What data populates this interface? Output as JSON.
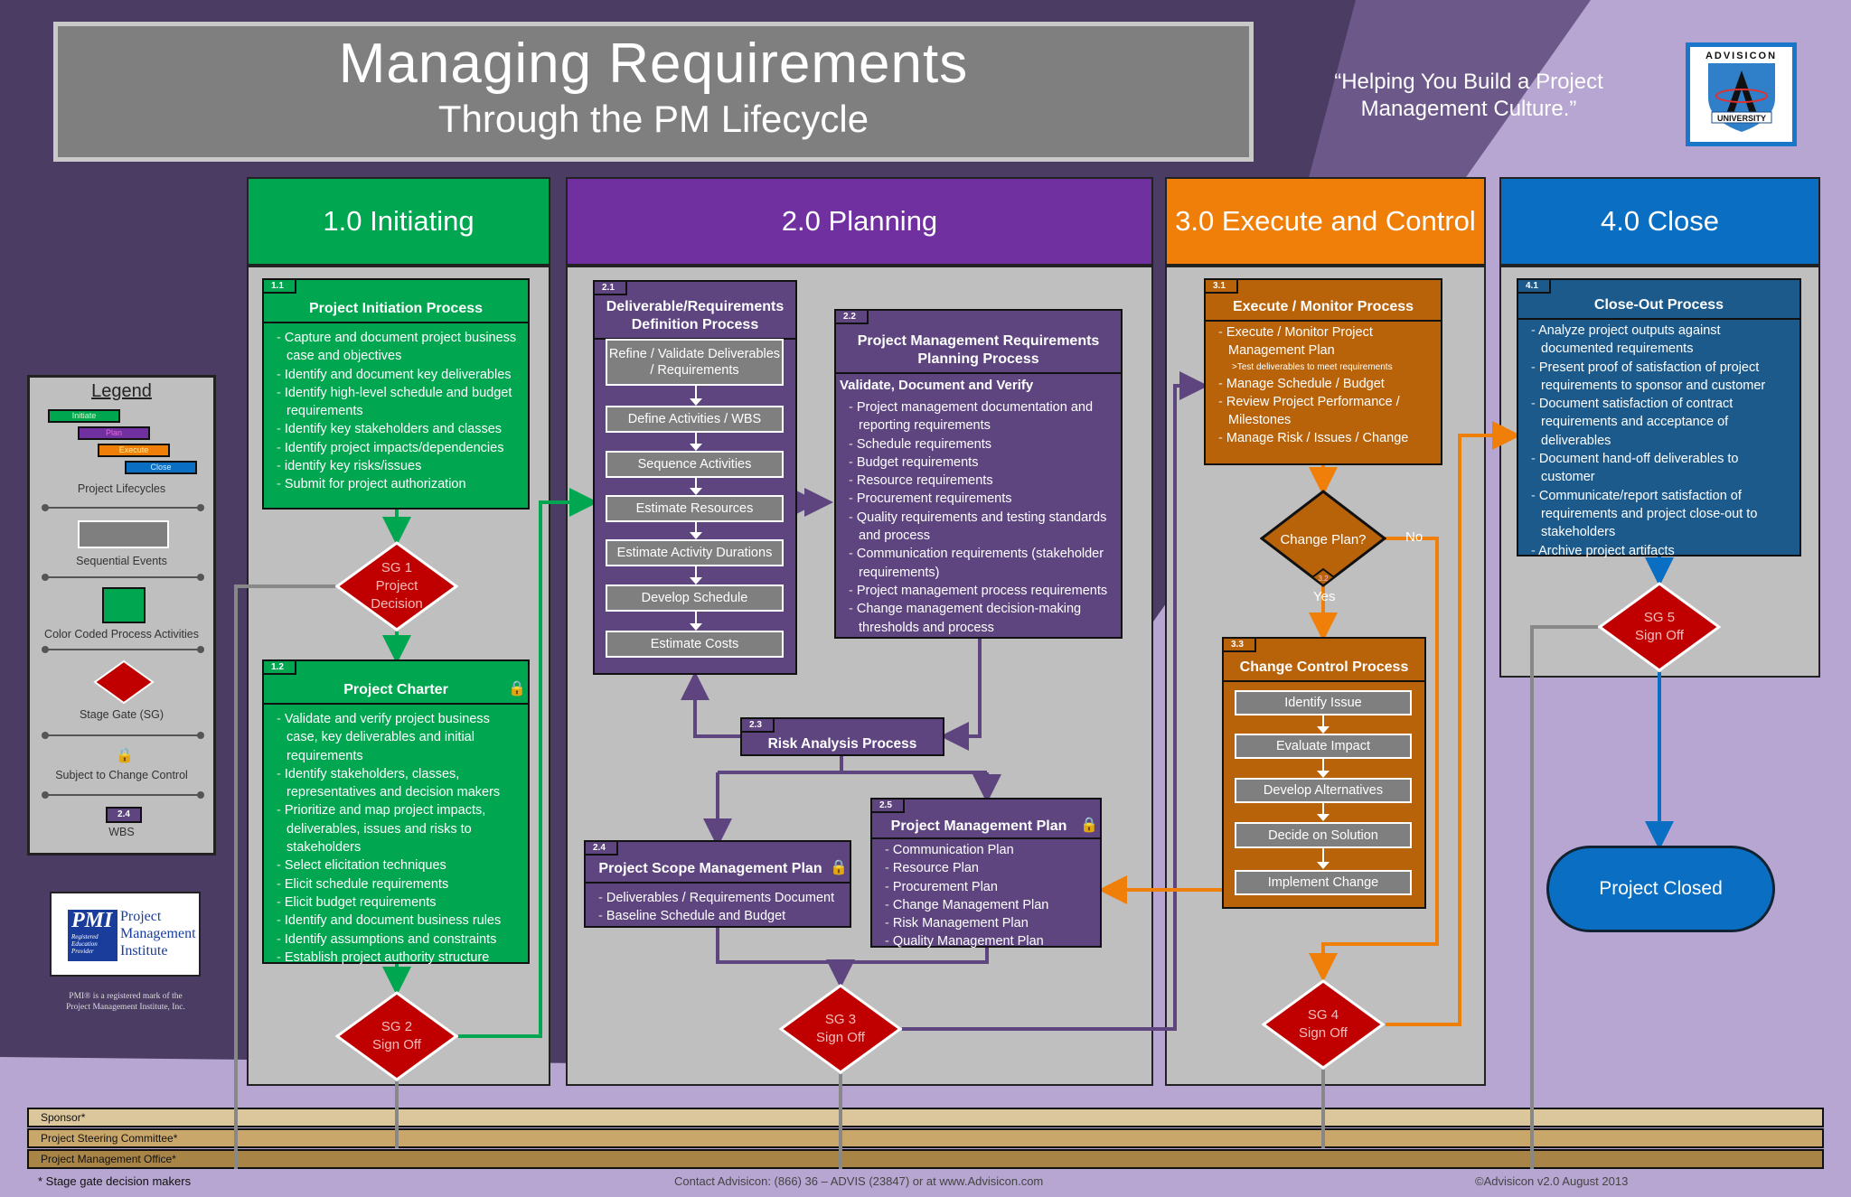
{
  "header": {
    "title": "Managing Requirements",
    "subtitle": "Through the PM Lifecycle",
    "tagline": "“Helping You Build a Project Management Culture.”",
    "logo_top": "ADVISICON",
    "logo_bottom": "UNIVERSITY"
  },
  "colors": {
    "initiate": "#00a650",
    "plan": "#7030a0",
    "execute": "#f07f0a",
    "close": "#0a6fc2",
    "gate": "#c00000",
    "process_purple": "#5e4580",
    "process_orange": "#b8630a",
    "process_blue": "#1c5a8c",
    "background": "#4a3c63"
  },
  "phases": [
    {
      "label": "1.0 Initiating"
    },
    {
      "label": "2.0 Planning"
    },
    {
      "label": "3.0 Execute and Control"
    },
    {
      "label": "4.0 Close"
    }
  ],
  "initiation": {
    "wbs": "1.1",
    "title": "Project Initiation Process",
    "items": [
      "Capture and document project business case and objectives",
      "Identify and document key deliverables",
      "Identify high-level schedule and budget requirements",
      "Identify key stakeholders and classes",
      "Identify project impacts/dependencies",
      "identify key risks/issues",
      "Submit for project authorization"
    ]
  },
  "charter": {
    "wbs": "1.2",
    "title": "Project Charter",
    "items": [
      "Validate and verify project business case, key deliverables and initial requirements",
      "Identify stakeholders, classes, representatives and decision makers",
      "Prioritize and map project impacts, deliverables, issues and risks to stakeholders",
      "Select elicitation techniques",
      "Elicit schedule requirements",
      "Elicit budget requirements",
      "Identify and document business rules",
      "Identify assumptions and constraints",
      "Establish project authority structure"
    ]
  },
  "definition": {
    "wbs": "2.1",
    "title": "Deliverable/Requirements Definition Process",
    "steps": [
      "Refine / Validate Deliverables / Requirements",
      "Define Activities / WBS",
      "Sequence Activities",
      "Estimate Resources",
      "Estimate Activity Durations",
      "Develop Schedule",
      "Estimate Costs"
    ]
  },
  "pm_planning": {
    "wbs": "2.2",
    "title": "Project Management Requirements Planning Process",
    "subtitle": "Validate, Document and Verify",
    "items": [
      "Project management documentation and reporting requirements",
      "Schedule requirements",
      "Budget requirements",
      "Resource requirements",
      "Procurement requirements",
      "Quality requirements and testing standards and process",
      "Communication requirements (stakeholder requirements)",
      "Project management process requirements",
      "Change management decision-making thresholds and process"
    ]
  },
  "risk": {
    "wbs": "2.3",
    "title": "Risk Analysis Process"
  },
  "scope_plan": {
    "wbs": "2.4",
    "title": "Project Scope Management Plan",
    "items": [
      "Deliverables / Requirements Document",
      "Baseline Schedule and Budget"
    ]
  },
  "pm_plan": {
    "wbs": "2.5",
    "title": "Project Management Plan",
    "items": [
      "Communication Plan",
      "Resource Plan",
      "Procurement Plan",
      "Change Management Plan",
      "Risk Management Plan",
      "Quality Management Plan"
    ]
  },
  "execute": {
    "wbs": "3.1",
    "title": "Execute / Monitor Process",
    "items": [
      "Execute / Monitor Project Management Plan",
      "Manage Schedule / Budget",
      "Review Project Performance / Milestones",
      "Manage Risk / Issues / Change"
    ],
    "sub_item": ">Test deliverables to meet requirements"
  },
  "change_plan": {
    "wbs": "3.2",
    "label": "Change Plan?",
    "yes": "Yes",
    "no": "No"
  },
  "change_control": {
    "wbs": "3.3",
    "title": "Change Control Process",
    "steps": [
      "Identify Issue",
      "Evaluate Impact",
      "Develop Alternatives",
      "Decide on Solution",
      "Implement Change"
    ]
  },
  "closeout": {
    "wbs": "4.1",
    "title": "Close-Out Process",
    "items": [
      "Analyze project outputs against documented requirements",
      "Present proof of satisfaction of project requirements to sponsor and customer",
      "Document satisfaction of contract requirements and acceptance of deliverables",
      "Document hand-off deliverables to customer",
      "Communicate/report satisfaction of requirements and project close-out to stakeholders",
      "Archive project artifacts"
    ]
  },
  "gates": {
    "sg1": [
      "SG 1",
      "Project",
      "Decision"
    ],
    "sg2": [
      "SG 2",
      "Sign Off"
    ],
    "sg3": [
      "SG 3",
      "Sign Off"
    ],
    "sg4": [
      "SG 4",
      "Sign Off"
    ],
    "sg5": [
      "SG 5",
      "Sign Off"
    ]
  },
  "project_closed": "Project Closed",
  "legend": {
    "title": "Legend",
    "bars": [
      "Initiate",
      "Plan",
      "Execute",
      "Close"
    ],
    "lifecycles": "Project Lifecycles",
    "sequential": "Sequential Events",
    "color_coded": "Color Coded Process Activities",
    "stage_gate": "Stage Gate (SG)",
    "change_control": "Subject to Change Control",
    "wbs_sample": "2.4",
    "wbs": "WBS"
  },
  "pmi": {
    "line1": "Project",
    "line2": "Management",
    "line3": "Institute",
    "badge": "Registered Education Provider",
    "note": "PMI® is a registered mark of the Project Management Institute, Inc."
  },
  "lanes": [
    "Sponsor*",
    "Project Steering Committee*",
    "Project Management Office*"
  ],
  "footer": {
    "note": "* Stage gate decision makers",
    "contact": "Contact Advisicon: (866) 36 – ADVIS (23847) or at www.Advisicon.com",
    "copyright": "©Advisicon v2.0 August 2013"
  }
}
